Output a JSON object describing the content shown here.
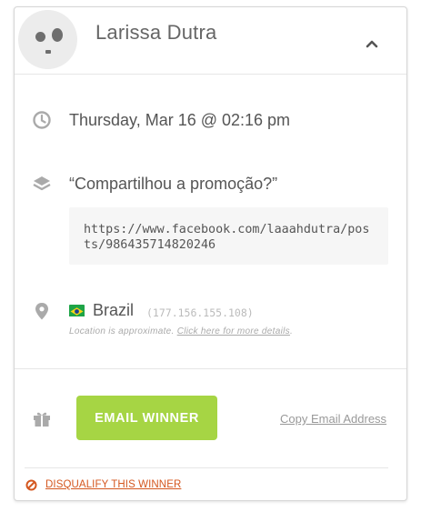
{
  "winner": {
    "name": "Larissa Dutra",
    "entry_time": "Thursday, Mar 16 @ 02:16 pm",
    "action_label": "“Compartilhou a promoção?”",
    "action_value": "https://www.facebook.com/laaahdutra/posts/986435714820246",
    "location": {
      "country": "Brazil",
      "ip": "(177.156.155.108)",
      "note": "Location is approximate.",
      "details_link": "Click here for more details"
    }
  },
  "actions": {
    "email_button": "EMAIL WINNER",
    "copy_email": "Copy Email Address",
    "disqualify": "DISQUALIFY THIS WINNER"
  },
  "icons": {
    "collapse": "chevron-up-icon",
    "time": "clock-icon",
    "entry": "layers-icon",
    "location": "map-pin-icon",
    "flag": "brazil-flag-icon",
    "prize": "gift-icon",
    "disqualify": "prohibited-icon"
  },
  "colors": {
    "accent_green": "#a6d544",
    "danger_orange": "#d4571f",
    "icon_gray": "#aaaaaa"
  }
}
